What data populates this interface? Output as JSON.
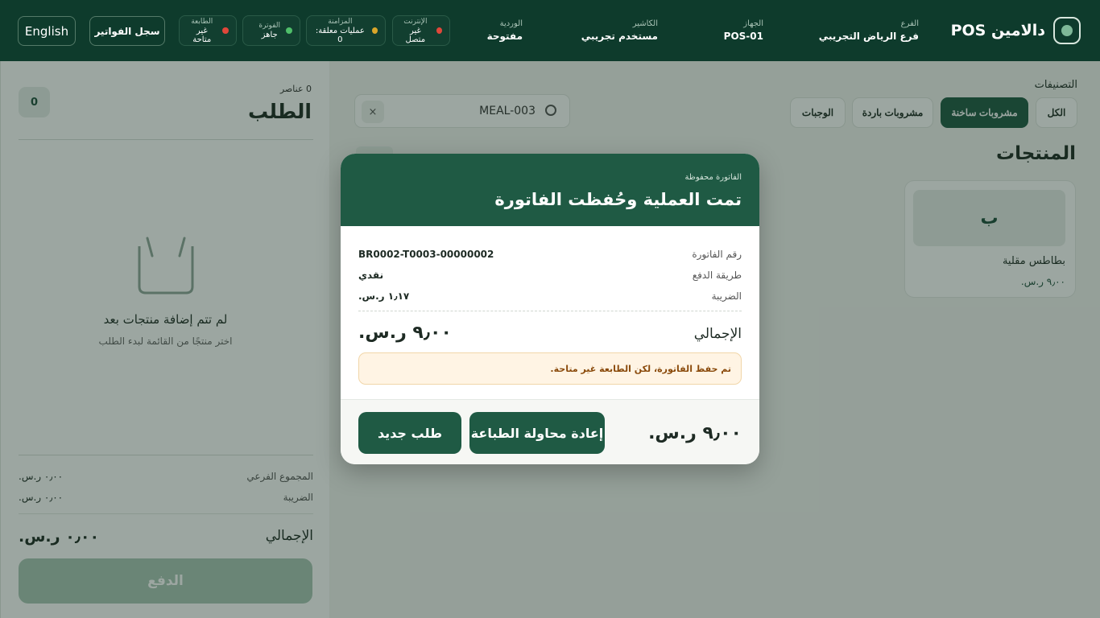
{
  "header": {
    "brand": "دالامين POS",
    "branch": {
      "label": "الفرع",
      "value": "فرع الرياض التجريبي"
    },
    "device": {
      "label": "الجهاز",
      "value": "POS-01"
    },
    "cashier": {
      "label": "الكاشير",
      "value": "مستخدم تجريبي"
    },
    "shift": {
      "label": "الوردية",
      "value": "مفتوحة"
    },
    "status": [
      {
        "label": "الإنترنت",
        "value": "غير متصل",
        "color": "#e0473a"
      },
      {
        "label": "المزامنة",
        "value": "عمليات معلقة: 0",
        "color": "#d9a62a"
      },
      {
        "label": "الفوترة",
        "value": "جاهز",
        "color": "#4fbf6a"
      },
      {
        "label": "الطابعة",
        "value": "غير متاحة",
        "color": "#e0473a"
      }
    ],
    "invoices_button": "سجل الفواتير",
    "language_button": "English"
  },
  "catalog": {
    "categories_title": "التصنيفات",
    "categories": [
      {
        "label": "الكل",
        "active": false
      },
      {
        "label": "مشروبات ساخنة",
        "active": true
      },
      {
        "label": "مشروبات باردة",
        "active": false
      },
      {
        "label": "الوجبات",
        "active": false
      }
    ],
    "search_value": "MEAL-003",
    "clear_symbol": "×",
    "products_title": "المنتجات",
    "products": [
      {
        "initial": "ب",
        "name": "بطاطس مقلية",
        "price": "٩٫٠٠ ر.س."
      }
    ]
  },
  "order": {
    "count": "0 عناصر",
    "title": "الطلب",
    "badge": "0",
    "empty_title": "لم تتم إضافة منتجات بعد",
    "empty_hint": "اختر منتجًا من القائمة لبدء الطلب",
    "subtotal_label": "المجموع الفرعي",
    "subtotal_value": "٠٫٠٠ ر.س.",
    "tax_label": "الضريبة",
    "tax_value": "٠٫٠٠ ر.س.",
    "total_label": "الإجمالي",
    "total_value": "٠٫٠٠ ر.س.",
    "pay_button": "الدفع"
  },
  "modal": {
    "subtitle": "الفاتورة محفوظة",
    "title": "تمت العملية وحُفظت الفاتورة",
    "rows": [
      {
        "label": "رقم الفاتورة",
        "value": "BR0002-T0003-00000002"
      },
      {
        "label": "طريقة الدفع",
        "value": "نقدي"
      },
      {
        "label": "الضريبة",
        "value": "١٫١٧ ر.س."
      }
    ],
    "total_label": "الإجمالي",
    "total_value": "٩٫٠٠ ر.س.",
    "warning": "تم حفظ الفاتورة، لكن الطابعة غير متاحة.",
    "footer_amount": "٩٫٠٠ ر.س.",
    "retry_print_button": "إعادة محاولة الطباعة",
    "new_order_button": "طلب جديد"
  }
}
